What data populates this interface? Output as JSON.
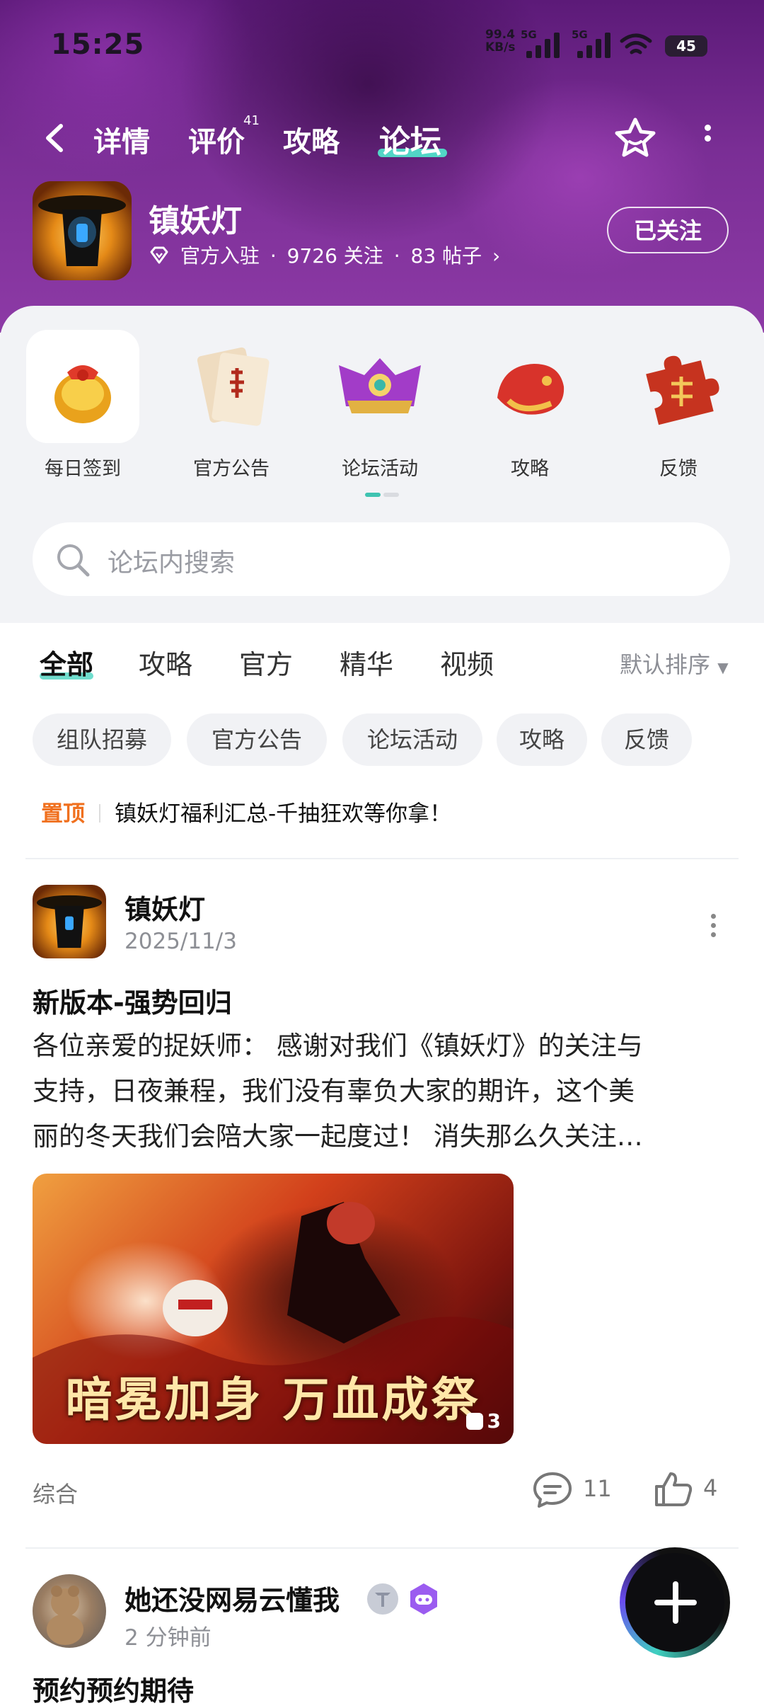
{
  "status_bar": {
    "time": "15:25",
    "net_speed_value": "99.4",
    "net_speed_unit": "KB/s",
    "sim1_tag": "5G",
    "sim2_tag": "5G",
    "battery": "45"
  },
  "nav": {
    "tabs": [
      {
        "label": "详情"
      },
      {
        "label": "评价",
        "badge": "41"
      },
      {
        "label": "攻略"
      },
      {
        "label": "论坛",
        "active": true
      }
    ]
  },
  "game": {
    "name": "镇妖灯",
    "official": "官方入驻",
    "followers": "9726 关注",
    "posts": "83 帖子",
    "follow_button": "已关注"
  },
  "quick_entries": [
    {
      "label": "每日签到",
      "icon": "gift-bag-icon",
      "selected": true
    },
    {
      "label": "官方公告",
      "icon": "scroll-icon"
    },
    {
      "label": "论坛活动",
      "icon": "treasure-chest-icon"
    },
    {
      "label": "攻略",
      "icon": "dragon-icon"
    },
    {
      "label": "反馈",
      "icon": "puzzle-piece-icon"
    }
  ],
  "search": {
    "placeholder": "论坛内搜索"
  },
  "filter_tabs": [
    "全部",
    "攻略",
    "官方",
    "精华",
    "视频"
  ],
  "sort_label": "默认排序",
  "chips": [
    "组队招募",
    "官方公告",
    "论坛活动",
    "攻略",
    "反馈"
  ],
  "pinned": {
    "tag": "置顶",
    "title": "镇妖灯福利汇总-千抽狂欢等你拿！"
  },
  "posts": [
    {
      "author": "镇妖灯",
      "date": "2025/11/3",
      "title": "新版本-强势回归",
      "body_lines": [
        "各位亲爱的捉妖师：  感谢对我们《镇妖灯》的关注与",
        "支持，日夜兼程，我们没有辜负大家的期许，这个美",
        "丽的冬天我们会陪大家一起度过！  消失那么久关注…"
      ],
      "image_text": "暗冕加身 万血成祭",
      "image_count": "3",
      "category": "综合",
      "comments": "11",
      "likes": "4"
    },
    {
      "author": "她还没网易云懂我",
      "date": "2 分钟前",
      "title": "预约预约期待"
    }
  ],
  "colors": {
    "accent": "#52d6c6",
    "pinned": "#f0701e",
    "header": "#7a2e95"
  }
}
